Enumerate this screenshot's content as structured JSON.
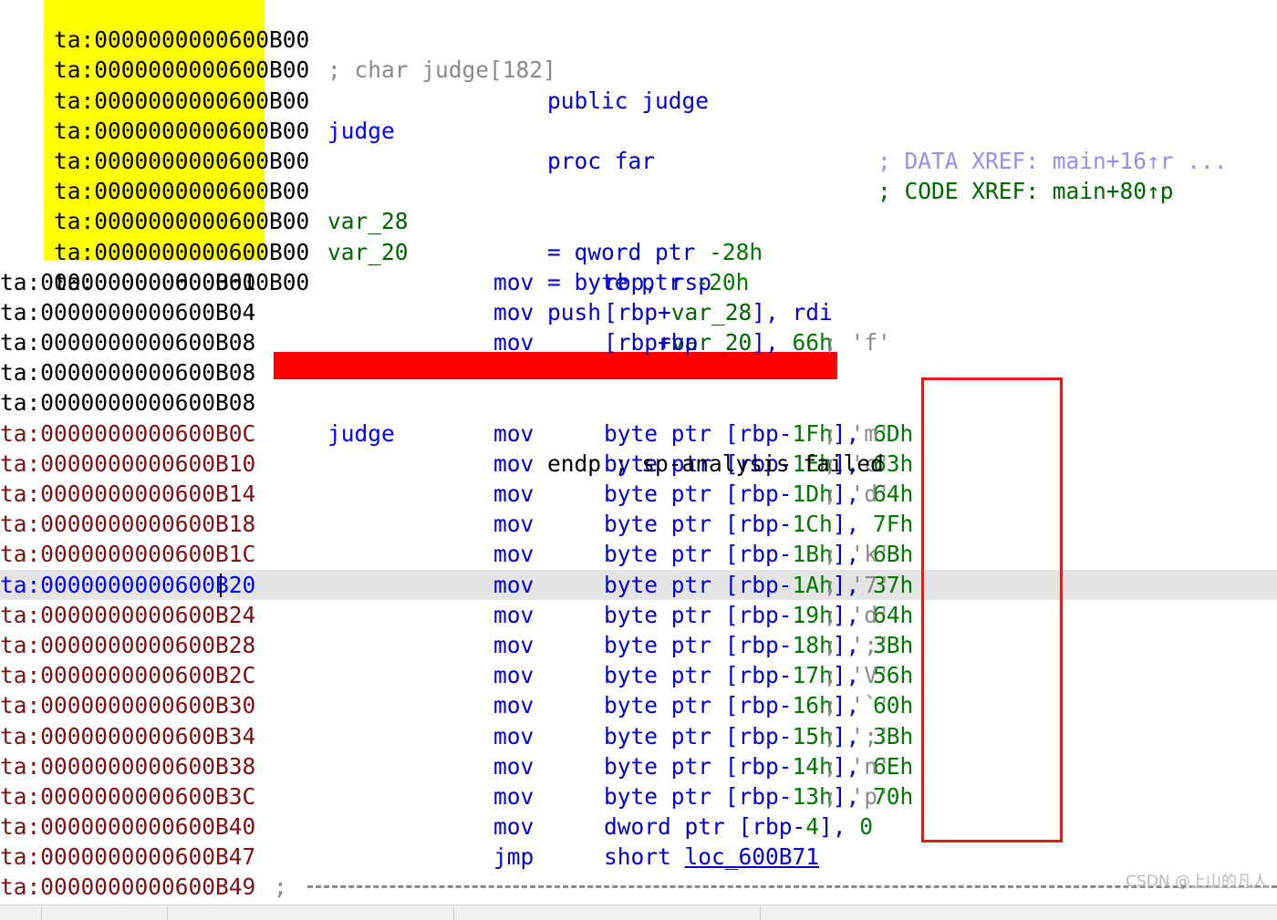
{
  "app": {
    "name": "IDA Pro disassembly view",
    "segment_prefix": "ta:"
  },
  "annotations": {
    "red_rectangle_label": "highlighted character-literal comment column",
    "yellow_highlight_label": "highlighted address range 0000000000600B00",
    "red_band_label": "judge endp ; sp-analysis failed"
  },
  "watermark": {
    "prefix": "CSDN @",
    "user": "上山的凡人"
  },
  "lines": [
    {
      "addr": "ta:0000000000600B00",
      "addr_color": "black",
      "label": "",
      "mnem": "",
      "ops": "",
      "comment": "; char judge[182]",
      "comment_color": "gray",
      "kind": "comment-top"
    },
    {
      "addr": "ta:0000000000600B00",
      "addr_color": "black",
      "label": "",
      "mnem": "public judge",
      "ops": "",
      "comment": "",
      "kind": "directive"
    },
    {
      "addr": "ta:0000000000600B00",
      "addr_color": "black",
      "label": "judge",
      "mnem": "proc far",
      "ops": "",
      "comment": "; CODE XREF: main+80↑p",
      "comment_color": "dgreen",
      "kind": "proc"
    },
    {
      "addr": "ta:0000000000600B00",
      "addr_color": "black",
      "label": "",
      "mnem": "",
      "ops": "",
      "comment": "; DATA XREF: main+16↑r ...",
      "comment_color": "lav",
      "kind": "xref"
    },
    {
      "addr": "ta:0000000000600B00",
      "addr_color": "black",
      "label": "",
      "mnem": "",
      "ops": "",
      "comment": "",
      "kind": "blank"
    },
    {
      "addr": "ta:0000000000600B00",
      "addr_color": "black",
      "label": "var_28",
      "mnem": "",
      "ops": "= qword ptr -28h",
      "comment": "",
      "kind": "vardef",
      "var_type": "qword ptr",
      "var_offset": "-28h"
    },
    {
      "addr": "ta:0000000000600B00",
      "addr_color": "black",
      "label": "var_20",
      "mnem": "",
      "ops": "= byte ptr -20h",
      "comment": "",
      "kind": "vardef",
      "var_type": "byte ptr",
      "var_offset": "-20h"
    },
    {
      "addr": "ta:0000000000600B00",
      "addr_color": "black",
      "label": "",
      "mnem": "",
      "ops": "",
      "comment": "",
      "kind": "blank"
    },
    {
      "addr": "ta:0000000000600B00",
      "addr_color": "black",
      "label": "",
      "mnem": "push",
      "ops": "rbp",
      "comment": "",
      "kind": "insn"
    },
    {
      "addr": "ta:0000000000600B01",
      "addr_color": "black",
      "label": "",
      "mnem": "mov",
      "ops": "rbp, rsp",
      "comment": "",
      "kind": "insn"
    },
    {
      "addr": "ta:0000000000600B04",
      "addr_color": "black",
      "label": "",
      "mnem": "mov",
      "ops": "[rbp+var_28], rdi",
      "comment": "",
      "kind": "insn-var"
    },
    {
      "addr": "ta:0000000000600B08",
      "addr_color": "black",
      "label": "",
      "mnem": "mov",
      "ops": "[rbp+var_20], 66h",
      "comment": "; 'f'",
      "comment_color": "gray",
      "kind": "insn-var-imm",
      "imm": "66h",
      "char": "'f'"
    },
    {
      "addr": "ta:0000000000600B08",
      "addr_color": "black",
      "label": "judge",
      "mnem": "endp ; sp-analysis failed",
      "ops": "",
      "comment": "",
      "kind": "endp"
    },
    {
      "addr": "ta:0000000000600B08",
      "addr_color": "black",
      "label": "",
      "mnem": "",
      "ops": "",
      "comment": "",
      "kind": "blank"
    },
    {
      "addr": "ta:0000000000600B0C",
      "addr_color": "red",
      "label": "",
      "mnem": "mov",
      "ops": "byte ptr [rbp-1Fh], 6Dh",
      "comment": "; 'm'",
      "comment_color": "gray",
      "kind": "insn-byte",
      "mem_off": "1Fh",
      "imm": "6Dh",
      "char": "'m'"
    },
    {
      "addr": "ta:0000000000600B10",
      "addr_color": "red",
      "label": "",
      "mnem": "mov",
      "ops": "byte ptr [rbp-1Eh], 63h",
      "comment": "; 'c'",
      "comment_color": "gray",
      "kind": "insn-byte",
      "mem_off": "1Eh",
      "imm": "63h",
      "char": "'c'"
    },
    {
      "addr": "ta:0000000000600B14",
      "addr_color": "red",
      "label": "",
      "mnem": "mov",
      "ops": "byte ptr [rbp-1Dh], 64h",
      "comment": "; 'd'",
      "comment_color": "gray",
      "kind": "insn-byte",
      "mem_off": "1Dh",
      "imm": "64h",
      "char": "'d'"
    },
    {
      "addr": "ta:0000000000600B18",
      "addr_color": "red",
      "label": "",
      "mnem": "mov",
      "ops": "byte ptr [rbp-1Ch], 7Fh",
      "comment": "",
      "comment_color": "gray",
      "kind": "insn-byte",
      "mem_off": "1Ch",
      "imm": "7Fh",
      "char": ""
    },
    {
      "addr": "ta:0000000000600B1C",
      "addr_color": "red",
      "label": "",
      "mnem": "mov",
      "ops": "byte ptr [rbp-1Bh], 6Bh",
      "comment": "; 'k'",
      "comment_color": "gray",
      "kind": "insn-byte",
      "mem_off": "1Bh",
      "imm": "6Bh",
      "char": "'k'"
    },
    {
      "addr": "ta:0000000000600B20",
      "addr_color": "blue",
      "selected": true,
      "label": "",
      "mnem": "mov",
      "ops": "byte ptr [rbp-1Ah], 37h",
      "comment": "; '7'",
      "comment_color": "gray",
      "kind": "insn-byte",
      "mem_off": "1Ah",
      "imm": "37h",
      "char": "'7'"
    },
    {
      "addr": "ta:0000000000600B24",
      "addr_color": "red",
      "label": "",
      "mnem": "mov",
      "ops": "byte ptr [rbp-19h], 64h",
      "comment": "; 'd'",
      "comment_color": "gray",
      "kind": "insn-byte",
      "mem_off": "19h",
      "imm": "64h",
      "char": "'d'"
    },
    {
      "addr": "ta:0000000000600B28",
      "addr_color": "red",
      "label": "",
      "mnem": "mov",
      "ops": "byte ptr [rbp-18h], 3Bh",
      "comment": "; ';'",
      "comment_color": "gray",
      "kind": "insn-byte",
      "mem_off": "18h",
      "imm": "3Bh",
      "char": "';'"
    },
    {
      "addr": "ta:0000000000600B2C",
      "addr_color": "red",
      "label": "",
      "mnem": "mov",
      "ops": "byte ptr [rbp-17h], 56h",
      "comment": "; 'V'",
      "comment_color": "gray",
      "kind": "insn-byte",
      "mem_off": "17h",
      "imm": "56h",
      "char": "'V'"
    },
    {
      "addr": "ta:0000000000600B30",
      "addr_color": "red",
      "label": "",
      "mnem": "mov",
      "ops": "byte ptr [rbp-16h], 60h",
      "comment": "; '`'",
      "comment_color": "gray",
      "kind": "insn-byte",
      "mem_off": "16h",
      "imm": "60h",
      "char": "'`'"
    },
    {
      "addr": "ta:0000000000600B34",
      "addr_color": "red",
      "label": "",
      "mnem": "mov",
      "ops": "byte ptr [rbp-15h], 3Bh",
      "comment": "; ';'",
      "comment_color": "gray",
      "kind": "insn-byte",
      "mem_off": "15h",
      "imm": "3Bh",
      "char": "';'"
    },
    {
      "addr": "ta:0000000000600B38",
      "addr_color": "red",
      "label": "",
      "mnem": "mov",
      "ops": "byte ptr [rbp-14h], 6Eh",
      "comment": "; 'n'",
      "comment_color": "gray",
      "kind": "insn-byte",
      "mem_off": "14h",
      "imm": "6Eh",
      "char": "'n'"
    },
    {
      "addr": "ta:0000000000600B3C",
      "addr_color": "red",
      "label": "",
      "mnem": "mov",
      "ops": "byte ptr [rbp-13h], 70h",
      "comment": "; 'p'",
      "comment_color": "gray",
      "kind": "insn-byte",
      "mem_off": "13h",
      "imm": "70h",
      "char": "'p'"
    },
    {
      "addr": "ta:0000000000600B40",
      "addr_color": "red",
      "label": "",
      "mnem": "mov",
      "ops": "dword ptr [rbp-4], 0",
      "comment": "",
      "kind": "insn-dword",
      "mem_off": "4",
      "imm": "0"
    },
    {
      "addr": "ta:0000000000600B47",
      "addr_color": "red",
      "label": "",
      "mnem": "jmp",
      "ops": "short loc_600B71",
      "comment": "",
      "kind": "insn-jmp",
      "target": "loc_600B71"
    },
    {
      "addr": "ta:0000000000600B49",
      "addr_color": "red",
      "label": "",
      "mnem": "",
      "ops": ";",
      "comment": "",
      "kind": "separator"
    }
  ],
  "colors": {
    "highlight_yellow": "#ffff00",
    "endp_band_red": "#ff0000",
    "annotation_rect_red": "#e81818",
    "selected_row_gray": "#e4e4e4",
    "address_black": "#000000",
    "address_maroon": "#7f1010",
    "address_selected_blue": "#0000ff",
    "instruction_blue": "#0000d0",
    "value_green": "#007700",
    "code_xref_green": "#006400",
    "data_xref_lavender": "#9c8cf0",
    "comment_gray": "#8a8a8a"
  }
}
